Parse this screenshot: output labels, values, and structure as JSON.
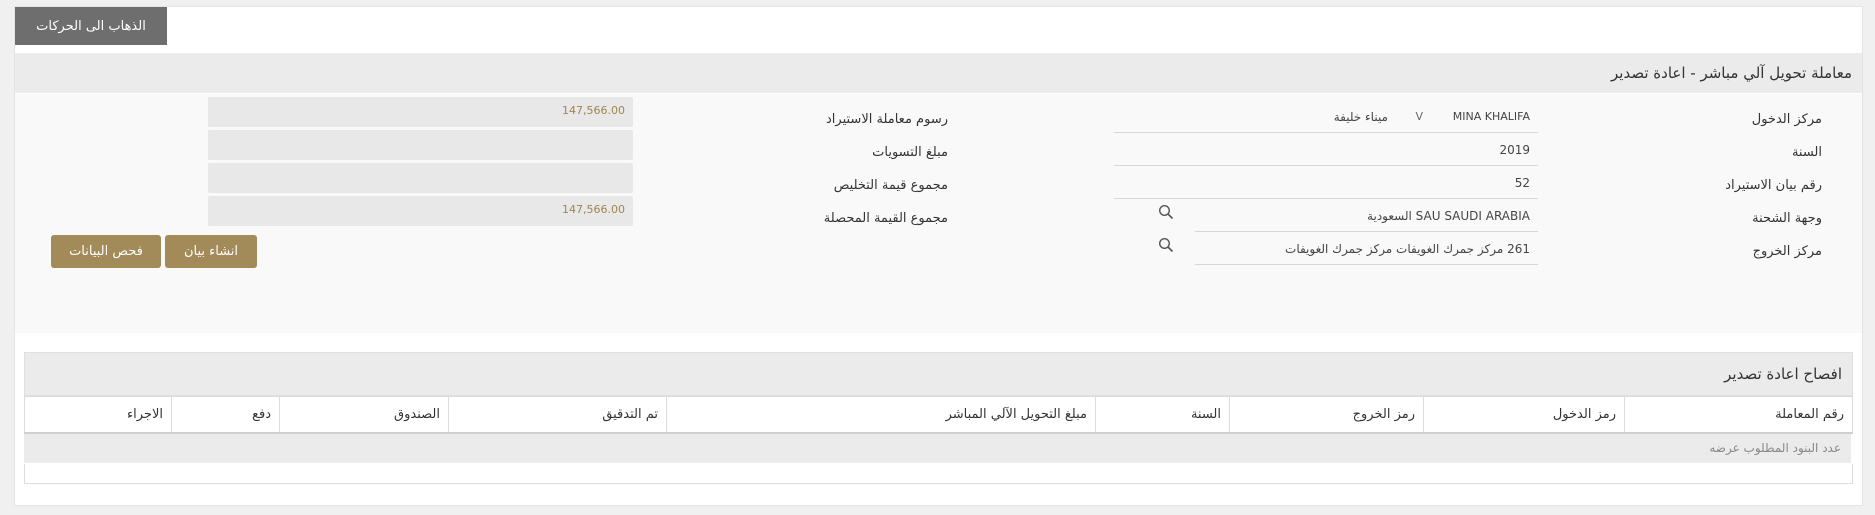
{
  "top_button": "الذهاب الى الحركات",
  "section_title": "معاملة تحويل آلي مباشر - اعادة تصدير",
  "left_fields": [
    {
      "label": "مركز الدخول",
      "value_en": "MINA KHALIFA",
      "value_ar": "ميناء خليفة",
      "dropdown": "V"
    },
    {
      "label": "السنة",
      "value": "2019"
    },
    {
      "label": "رقم بيان الاستيراد",
      "value": "52"
    },
    {
      "label": "وجهة الشحنة",
      "value": "SAU SAUDI ARABIA السعودية"
    },
    {
      "label": "مركز الخروج",
      "value": "261 مركز جمرك الغويفات مركز جمرك الغويفات"
    }
  ],
  "right_fields": [
    {
      "label": "رسوم معاملة الاستيراد",
      "value": "147,566.00"
    },
    {
      "label": "مبلغ التسويات",
      "value": ""
    },
    {
      "label": "مجموع قيمة التخليص",
      "value": ""
    },
    {
      "label": "مجموع القيمة المحصلة",
      "value": "147,566.00"
    }
  ],
  "buttons": {
    "create": "انشاء بيان",
    "check": "فحص البيانات"
  },
  "table": {
    "title": "افصاح اعادة تصدير",
    "columns": [
      "رقم المعاملة",
      "رمز الدخول",
      "رمز الخروج",
      "السنة",
      "مبلغ التحويل الآلي المباشر",
      "تم التدقيق",
      "الصندوق",
      "دفع",
      "الاجراء"
    ],
    "empty_text": "عدد البنود المطلوب عرضه"
  },
  "colors": {
    "accent": "#a38a59",
    "top_button_bg": "#6e6e6e",
    "header_bg": "#ebebeb"
  }
}
